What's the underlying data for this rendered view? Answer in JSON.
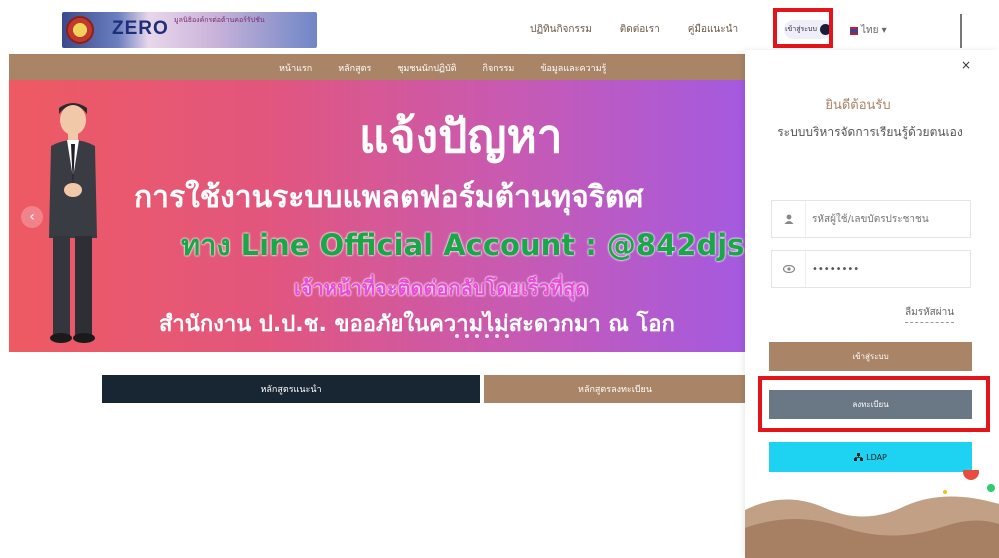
{
  "header": {
    "logo_text": "ZERO",
    "logo_subtitle": "มูลนิธิองค์กรต่อต้านคอร์รัปชัน",
    "links": [
      "ปฏิทินกิจกรรม",
      "ติดต่อเรา",
      "คู่มือแนะนำ"
    ],
    "user_button_label": "เข้าสู่ระบบ",
    "language": "ไทย ▾"
  },
  "nav": {
    "items": [
      "หน้าแรก",
      "หลักสูตร",
      "ชุมชนนักปฏิบัติ",
      "กิจกรรม",
      "ข้อมูลและความรู้"
    ]
  },
  "banner": {
    "title": "แจ้งปัญหา",
    "line2": "การใช้งานระบบแพลตฟอร์มต้านทุจริตศ",
    "line3": "ทาง Line Official Account : @842djs",
    "line4": "เจ้าหน้าที่จะติดต่อกลับโดยเร็วที่สุด",
    "line5": "สำนักงาน ป.ป.ช. ขออภัยในความไม่สะดวกมา ณ โอก",
    "prev_arrow": "‹"
  },
  "buttons": {
    "recommended_courses": "หลักสูตรแนะนำ",
    "registered_courses": "หลักสูตรลงทะเบียน"
  },
  "login_panel": {
    "close": "×",
    "welcome": "ยินดีต้อนรับ",
    "subtitle": "ระบบบริหารจัดการเรียนรู้ด้วยตนเอง",
    "username_placeholder": "รหัสผู้ใช้/เลขบัตรประชาชน",
    "password_value": "••••••••",
    "forgot_password": "ลืมรหัสผ่าน",
    "login_button": "เข้าสู่ระบบ",
    "register_button": "ลงทะเบียน",
    "ldap_button": "LDAP"
  },
  "colors": {
    "brown": "#a98466",
    "navy": "#182532",
    "gray_button": "#6a7784",
    "cyan": "#1ed3f2",
    "highlight_red": "#e3151a"
  }
}
